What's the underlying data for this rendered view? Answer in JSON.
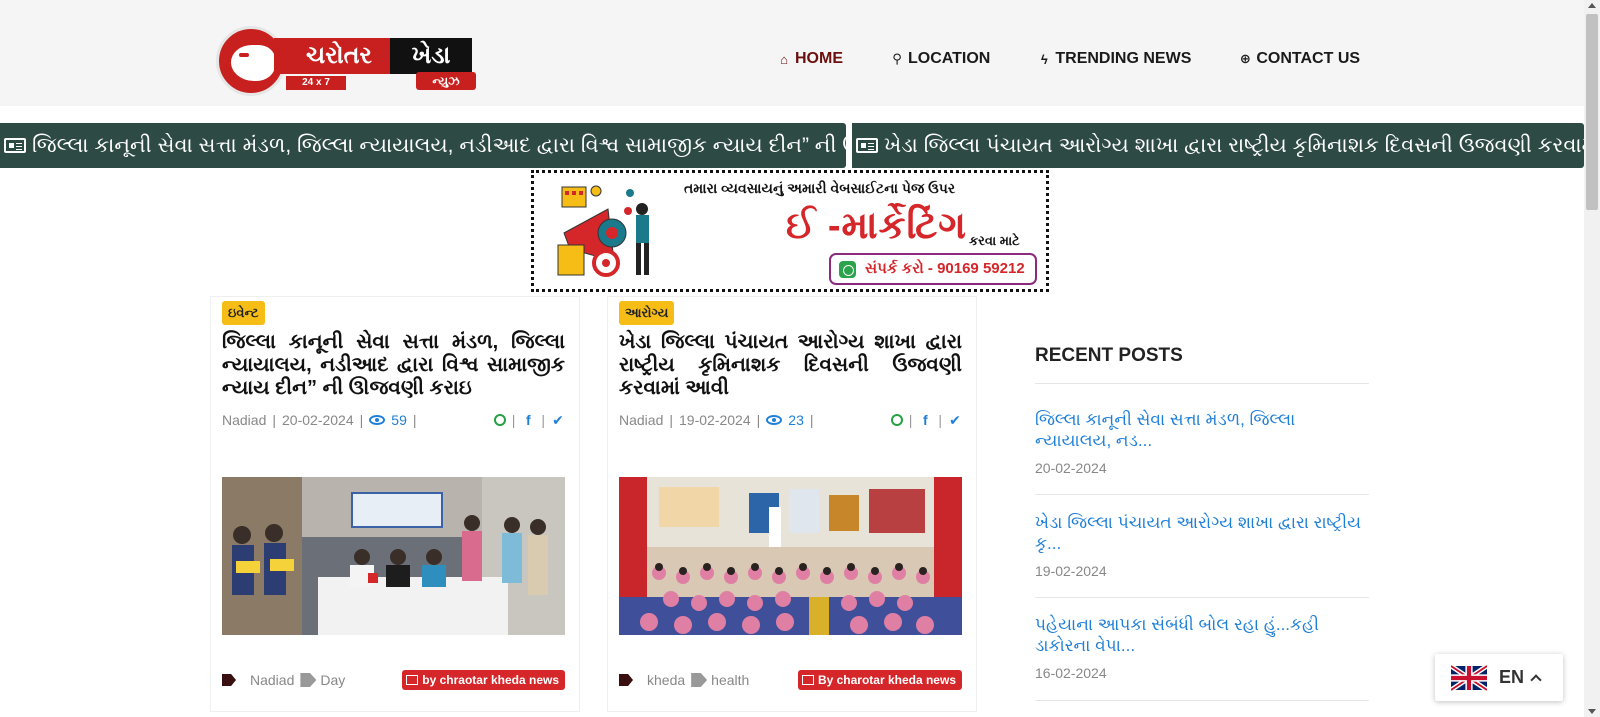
{
  "logo": {
    "brand_left": "ચરોતર",
    "brand_right": "ખેડા",
    "tagline": "24 x 7",
    "news": "ન્યુઝ"
  },
  "nav": {
    "items": [
      {
        "label": "HOME",
        "icon": "home-icon"
      },
      {
        "label": "LOCATION",
        "icon": "map-marker-icon"
      },
      {
        "label": "TRENDING NEWS",
        "icon": "bolt-icon"
      },
      {
        "label": "CONTACT US",
        "icon": "life-ring-icon"
      }
    ]
  },
  "ticker": {
    "items": [
      {
        "text": "જિલ્લા કાનૂની સેવા સત્તા મંડળ, જિલ્લા ન્યાયાલય, નડીઆદ દ્વારા વિશ્વ સામાજીક ન્યાય દીન” ની ઊજવણી કરાઇ"
      },
      {
        "text": "ખેડા જિલ્લા પંચાયત આરોગ્ય શાખા દ્વારા રાષ્ટ્રીય કૃમિનાશક દિવસની ઉજવણી કરવામાં આવી"
      }
    ]
  },
  "ad": {
    "top_text": "તમારા વ્યવસાયનું અમારી વેબસાઈટના પેજ ઉપર",
    "main_text": "ઈ -માર્કેટિંગ",
    "side_text": "કરવા માટે",
    "contact_text": "સંપર્ક કરો - 90169 59212"
  },
  "posts": [
    {
      "category": "ઇવેન્ટ",
      "title": "જિલ્લા કાનૂની સેવા સત્તા મંડળ, જિલ્લા ન્યાયાલય, નડીઆદ દ્વારા વિશ્વ સામાજીક ન્યાય દીન” ની ઊજવણી કરાઇ",
      "location": "Nadiad",
      "date": "20-02-2024",
      "views": "59",
      "tags": [
        "Nadiad",
        "Day"
      ],
      "author": "by chraotar kheda news"
    },
    {
      "category": "આરોગ્ય",
      "title": "ખેડા જિલ્લા પંચાયત આરોગ્ય શાખા દ્વારા રાષ્ટ્રીય કૃમિનાશક દિવસની ઉજવણી કરવામાં આવી",
      "location": "Nadiad",
      "date": "19-02-2024",
      "views": "23",
      "tags": [
        "kheda",
        "health"
      ],
      "author": "By charotar kheda news"
    }
  ],
  "sidebar": {
    "title": "RECENT POSTS",
    "posts": [
      {
        "title": "જિલ્લા કાનૂની સેવા સત્તા મંડળ, જિલ્લા ન્યાયાલય, નડ...",
        "date": "20-02-2024"
      },
      {
        "title": "ખેડા જિલ્લા પંચાયત આરોગ્ય શાખા દ્વારા રાષ્ટ્રીય કૃ...",
        "date": "19-02-2024"
      },
      {
        "title": "પહેયાના આપકા સંબંધી બોલ રહા હું...કહી ડાકોરના વેપા...",
        "date": "16-02-2024"
      }
    ]
  },
  "language": {
    "label": "EN"
  },
  "colors": {
    "ticker_bg": "#2d4a45",
    "brand_red": "#c8201e",
    "badge_yellow": "#f6bd16",
    "link_blue": "#1e7fd8"
  }
}
